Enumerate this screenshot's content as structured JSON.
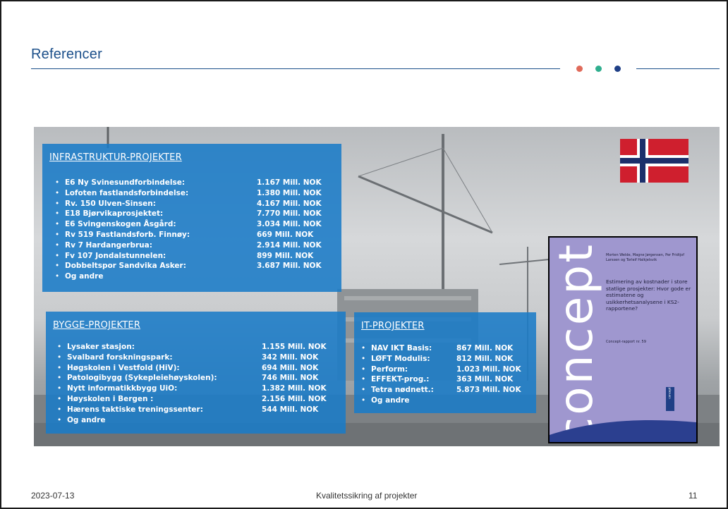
{
  "slide": {
    "title": "Referencer",
    "footer_date": "2023-07-13",
    "footer_center": "Kvalitetssikring af projekter",
    "footer_page": "11",
    "accent_dots": [
      "#e06a5a",
      "#2fae8e",
      "#1f3f86"
    ]
  },
  "infra": {
    "heading": "INFRASTRUKTUR-PROJEKTER",
    "items": [
      {
        "label": "E6 Ny Svinesundforbindelse:",
        "value": "1.167 Mill. NOK"
      },
      {
        "label": "Lofoten fastlandsforbindelse:",
        "value": "1.380 Mill. NOK"
      },
      {
        "label": "Rv. 150 Ulven-Sinsen:",
        "value": "4.167 Mill. NOK"
      },
      {
        "label": "E18 Bjørvikaprosjektet:",
        "value": "7.770 Mill. NOK"
      },
      {
        "label": "E6 Svingenskogen Åsgård:",
        "value": "3.034 Mill. NOK"
      },
      {
        "label": "Rv 519 Fastlandsforb. Finnøy:",
        "value": "669 Mill. NOK"
      },
      {
        "label": "Rv 7 Hardangerbrua:",
        "value": "2.914 Mill. NOK"
      },
      {
        "label": "Fv 107 Jondalstunnelen:",
        "value": "899 Mill. NOK"
      },
      {
        "label": "Dobbeltspor Sandvika Asker:",
        "value": "3.687 Mill. NOK"
      },
      {
        "label": "Og andre",
        "value": ""
      }
    ]
  },
  "bygge": {
    "heading": "BYGGE-PROJEKTER",
    "items": [
      {
        "label": "Lysaker stasjon:",
        "value": "1.155 Mill. NOK"
      },
      {
        "label": "Svalbard forskningspark:",
        "value": "342 Mill. NOK"
      },
      {
        "label": "Høgskolen i Vestfold (HiV):",
        "value": "694 Mill. NOK"
      },
      {
        "label": "Patologibygg (Sykepleiehøyskolen):",
        "value": "746 Mill. NOK"
      },
      {
        "label": "Nytt informatikkbygg UiO:",
        "value": "1.382 Mill. NOK"
      },
      {
        "label": "Høyskolen i Bergen :",
        "value": "2.156 Mill. NOK"
      },
      {
        "label": "Hærens taktiske treningssenter:",
        "value": "544 Mill. NOK"
      },
      {
        "label": "Og andre",
        "value": ""
      }
    ]
  },
  "it": {
    "heading": "IT-PROJEKTER",
    "items": [
      {
        "label": "NAV IKT Basis:",
        "value": "867 Mill. NOK"
      },
      {
        "label": "LØFT Modulis:",
        "value": "812 Mill. NOK"
      },
      {
        "label": "Perform:",
        "value": "1.023 Mill. NOK"
      },
      {
        "label": "EFFEKT-prog.:",
        "value": "363 Mill. NOK"
      },
      {
        "label": "Tetra nødnett.:",
        "value": "5.873 Mill. NOK"
      },
      {
        "label": "Og andre",
        "value": ""
      }
    ]
  },
  "book": {
    "spine": "concept",
    "authors": "Morten Welde, Magne Jørgensen, Per Fridtjof Larssen og Torleif Halkjelsvik",
    "title": "Estimering av kostnader i store statlige prosjekter: Hvor gode er estimatene og usikkerhetsanalysene i KS2-rapportene?",
    "report": "Concept-rapport nr. 59",
    "logo_text": "concept"
  }
}
